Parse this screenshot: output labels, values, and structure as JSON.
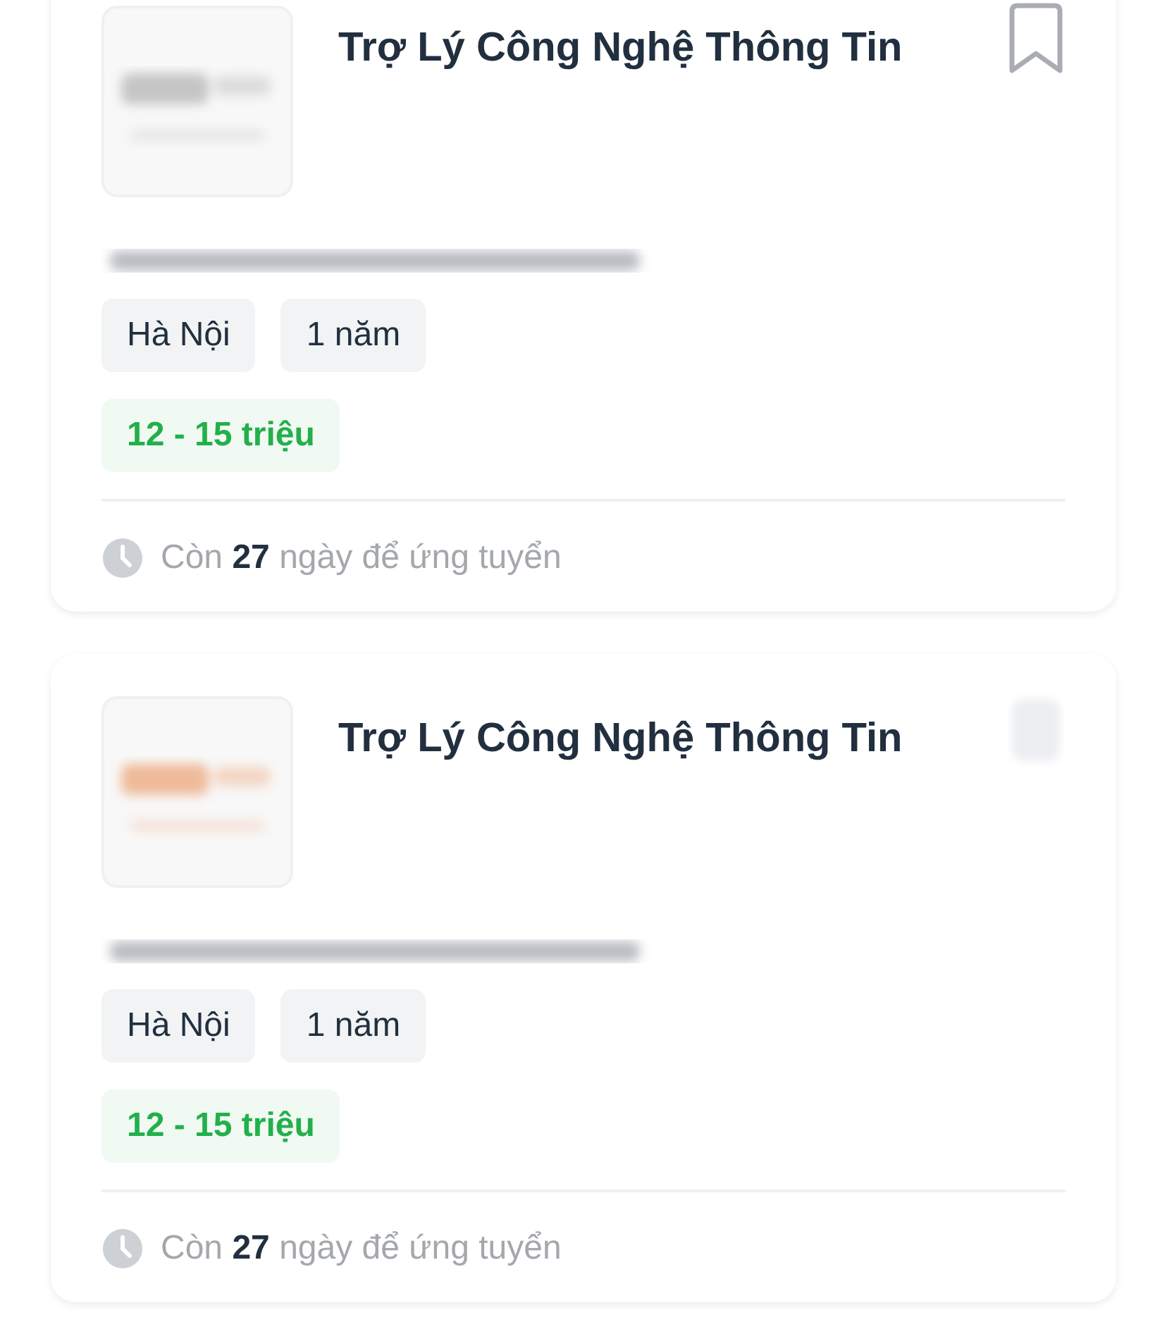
{
  "jobs": [
    {
      "title": "Trợ Lý Công Nghệ Thông Tin",
      "bookmark": {
        "blurred": false
      },
      "tags": [
        "Hà Nội",
        "1 năm"
      ],
      "salary": "12 - 15 triệu",
      "deadline": "Còn **27** ngày để ứng tuyển"
    },
    {
      "title": "Trợ Lý Công Nghệ Thông Tin",
      "bookmark": {
        "blurred": true
      },
      "tags": [
        "Hà Nội",
        "1 năm"
      ],
      "salary": "12 - 15 triệu",
      "deadline": "Còn **27** ngày để ứng tuyển"
    }
  ]
}
